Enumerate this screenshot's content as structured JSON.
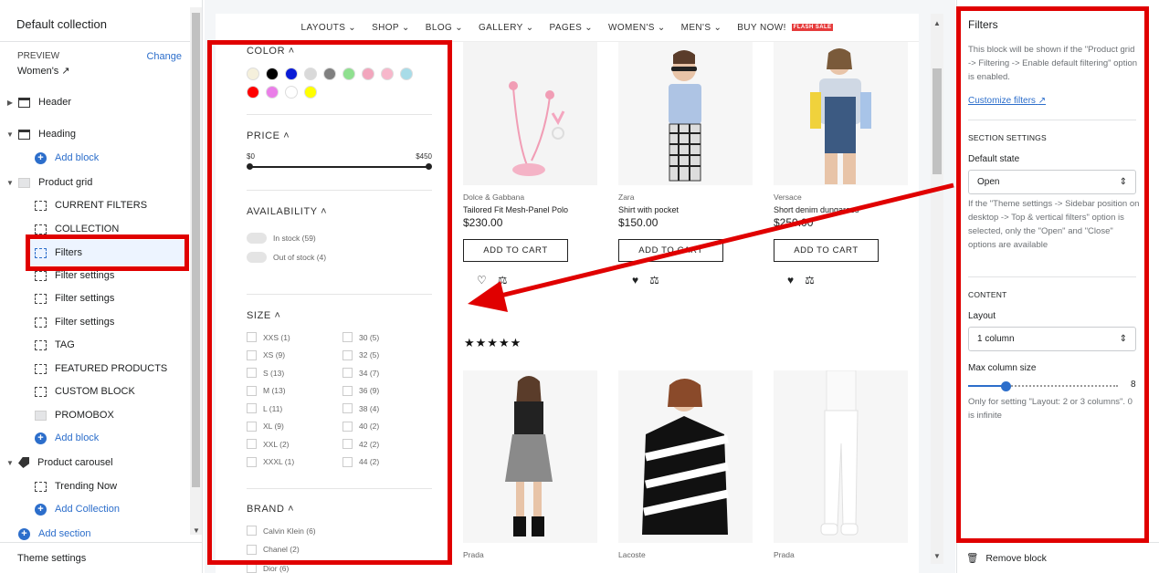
{
  "left_panel": {
    "title": "Default collection",
    "preview_label": "PREVIEW",
    "preview_change": "Change",
    "preview_value": "Women's",
    "tree": [
      {
        "label": "Header",
        "icon": "section-icon"
      },
      {
        "label": "Heading",
        "icon": "section-icon"
      },
      {
        "label": "Add block",
        "icon": "plus-icon"
      },
      {
        "label": "Product grid",
        "icon": "image-icon"
      },
      {
        "label": "CURRENT FILTERS",
        "icon": "block-icon"
      },
      {
        "label": "COLLECTION",
        "icon": "block-icon"
      },
      {
        "label": "Filters",
        "icon": "block-icon"
      },
      {
        "label": "Filter settings",
        "icon": "block-icon"
      },
      {
        "label": "Filter settings",
        "icon": "block-icon"
      },
      {
        "label": "Filter settings",
        "icon": "block-icon"
      },
      {
        "label": "TAG",
        "icon": "block-icon"
      },
      {
        "label": "FEATURED PRODUCTS",
        "icon": "block-icon"
      },
      {
        "label": "CUSTOM BLOCK",
        "icon": "block-icon"
      },
      {
        "label": "PROMOBOX",
        "icon": "image-icon"
      },
      {
        "label": "Add block",
        "icon": "plus-icon"
      },
      {
        "label": "Product carousel",
        "icon": "tag-icon"
      },
      {
        "label": "Trending Now",
        "icon": "block-icon"
      },
      {
        "label": "Add Collection",
        "icon": "plus-icon"
      },
      {
        "label": "Add section",
        "icon": "plus-icon"
      }
    ],
    "theme_settings": "Theme settings"
  },
  "store": {
    "nav": [
      "LAYOUTS",
      "SHOP",
      "BLOG",
      "GALLERY",
      "PAGES",
      "WOMEN'S",
      "MEN'S",
      "BUY NOW!"
    ],
    "flash_badge": "FLASH SALE",
    "filters": {
      "color_title": "COLOR",
      "colors": [
        "#f5f0dc",
        "#000000",
        "#0a1bd6",
        "#d9d9d9",
        "#808080",
        "#8fe08f",
        "#f2a6bd",
        "#f7b7cb",
        "#a8dce8",
        "#ff0000",
        "#ea7ee8",
        "#ffffff",
        "#ffff00"
      ],
      "price_title": "PRICE",
      "price_min": "$0",
      "price_max": "$450",
      "availability_title": "AVAILABILITY",
      "availability": [
        "In stock (59)",
        "Out of stock (4)"
      ],
      "size_title": "SIZE",
      "sizes_left": [
        "XXS (1)",
        "XS (9)",
        "S (13)",
        "M (13)",
        "L (11)",
        "XL (9)",
        "XXL (2)",
        "XXXL (1)"
      ],
      "sizes_right": [
        "30 (5)",
        "32 (5)",
        "34 (7)",
        "36 (9)",
        "38 (4)",
        "40 (2)",
        "42 (2)",
        "44 (2)"
      ],
      "brand_title": "BRAND",
      "brands": [
        "Calvin Klein (6)",
        "Chanel (2)",
        "Dior (6)"
      ]
    },
    "products": [
      {
        "brand": "Dolce & Gabbana",
        "name": "Tailored Fit Mesh-Panel Polo",
        "price": "$230.00",
        "button": "ADD TO CART",
        "image": "pink-earphones"
      },
      {
        "brand": "Zara",
        "name": "Shirt with pocket",
        "price": "$150.00",
        "button": "ADD TO CART",
        "image": "woman-plaid-pants"
      },
      {
        "brand": "Versace",
        "name": "Short denim dungarees",
        "price": "$250.00",
        "button": "ADD TO CART",
        "image": "woman-denim-dungarees"
      }
    ],
    "products_row2": [
      {
        "brand": "Prada",
        "image": "woman-pinafore-dress"
      },
      {
        "brand": "Lacoste",
        "image": "woman-striped-sweater"
      },
      {
        "brand": "Prada",
        "image": "woman-white-outfit"
      }
    ],
    "rating": "★★★★★"
  },
  "right_panel": {
    "title": "Filters",
    "description": "This block will be shown if the \"Product grid -> Filtering -> Enable default filtering\" option is enabled.",
    "customize_link": "Customize filters",
    "section_settings": "SECTION SETTINGS",
    "default_state_label": "Default state",
    "default_state_value": "Open",
    "default_state_help": "If the \"Theme settings -> Sidebar position on desktop -> Top & vertical filters\" option is selected, only the \"Open\" and \"Close\" options are available",
    "content_heading": "CONTENT",
    "layout_label": "Layout",
    "layout_value": "1 column",
    "max_column_label": "Max column size",
    "max_column_value": "8",
    "max_column_fraction": 0.25,
    "max_column_help": "Only for setting \"Layout: 2 or 3 columns\". 0 is infinite",
    "remove_block": "Remove block"
  },
  "colors": {
    "accent": "#2c6ecb",
    "highlight": "#e00000"
  }
}
